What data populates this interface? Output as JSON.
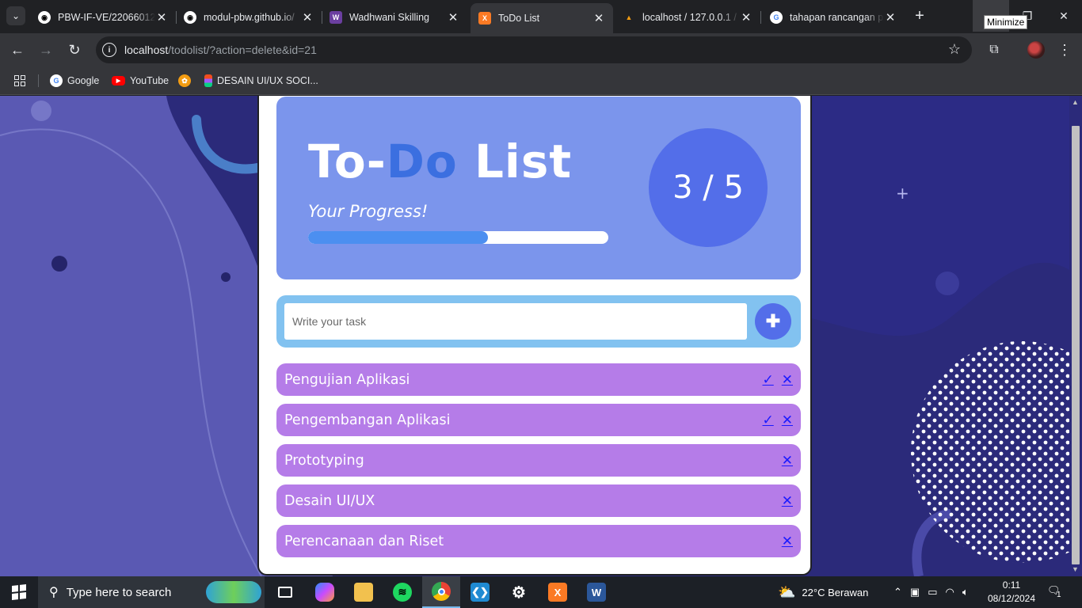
{
  "browser": {
    "tabs": [
      {
        "title": "PBW-IF-VE/22066012",
        "icon": "github-icon",
        "active": false
      },
      {
        "title": "modul-pbw.github.io/",
        "icon": "github-icon",
        "active": false
      },
      {
        "title": "Wadhwani Skilling",
        "icon": "wadhwani-icon",
        "active": false
      },
      {
        "title": "ToDo List",
        "icon": "xampp-icon",
        "active": true
      },
      {
        "title": "localhost / 127.0.0.1 /",
        "icon": "phpmyadmin-icon",
        "active": false
      },
      {
        "title": "tahapan rancangan p",
        "icon": "google-icon",
        "active": false
      }
    ],
    "tooltip": "Minimize",
    "url_host": "localhost",
    "url_path": "/todolist/?action=delete&id=21",
    "bookmarks": [
      {
        "label": "Google",
        "icon": "google-icon"
      },
      {
        "label": "YouTube",
        "icon": "youtube-icon"
      },
      {
        "label": "",
        "icon": "app-icon"
      },
      {
        "label": "DESAIN UI/UX SOCI...",
        "icon": "figma-icon"
      }
    ]
  },
  "todo": {
    "title_part1": "To-",
    "title_highlight": "Do",
    "title_part2": " List",
    "subtitle": "Your Progress!",
    "progress_fraction": 0.6,
    "counter": "3 / 5",
    "input_placeholder": "Write your task",
    "add_symbol": "✚",
    "tasks": [
      {
        "label": "Pengujian Aplikasi",
        "done": true
      },
      {
        "label": "Pengembangan Aplikasi",
        "done": true
      },
      {
        "label": "Prototyping",
        "done": false
      },
      {
        "label": "Desain UI/UX",
        "done": false
      },
      {
        "label": "Perencanaan dan Riset",
        "done": false
      }
    ],
    "check_symbol": "✓",
    "delete_symbol": "✕"
  },
  "taskbar": {
    "search_placeholder": "Type here to search",
    "weather": "22°C  Berawan",
    "time": "0:11",
    "date": "08/12/2024",
    "notification_count": "1"
  },
  "colors": {
    "hero": "#7b95ec",
    "accent": "#536ee9",
    "task": "#b57ce8",
    "addbar": "#82c2f0",
    "page_bg": "#2b2a7a"
  }
}
